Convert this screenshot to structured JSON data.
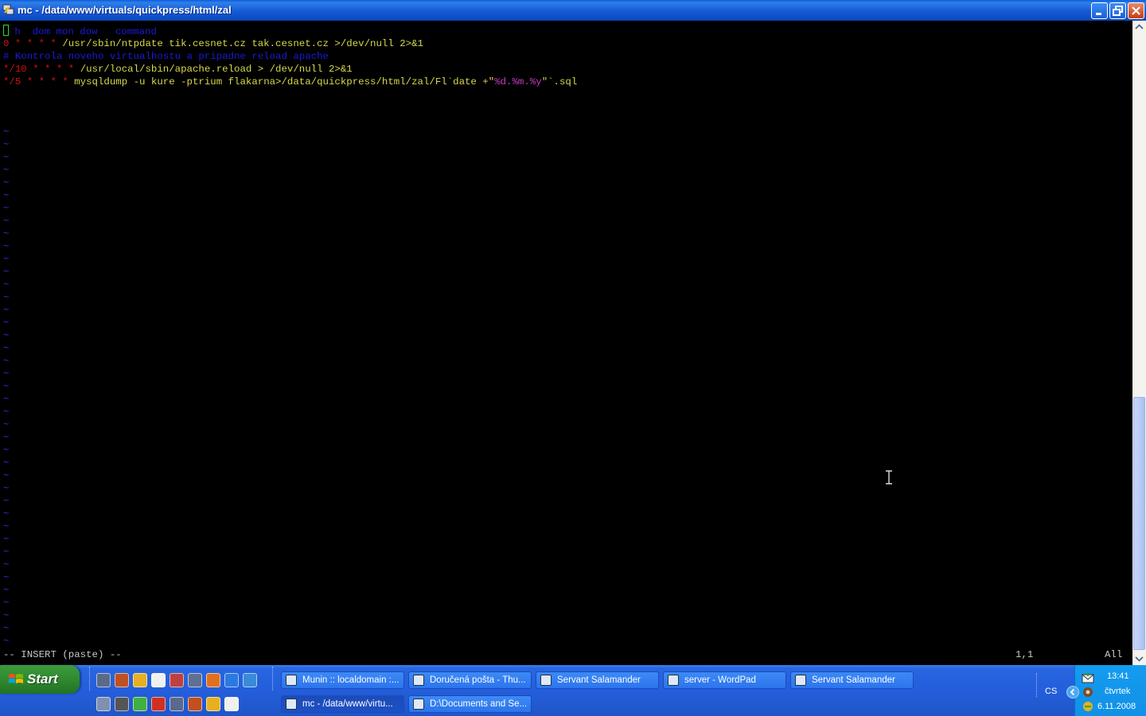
{
  "window": {
    "title": "mc - /data/www/virtuals/quickpress/html/zal"
  },
  "editor": {
    "lines": [
      {
        "segments": [
          {
            "text": "# h  dom mon dow   command",
            "color": "blue"
          }
        ]
      },
      {
        "segments": [
          {
            "text": "0 ",
            "color": "red"
          },
          {
            "text": "* * * * ",
            "color": "red"
          },
          {
            "text": "/usr/sbin/ntpdate tik.cesnet.cz tak.cesnet.cz >/dev/null 2>&1",
            "color": "yellow"
          }
        ]
      },
      {
        "segments": [
          {
            "text": "# Kontrola noveho virtualhostu a pripadne reload apache",
            "color": "blue"
          }
        ]
      },
      {
        "segments": [
          {
            "text": "*/10 ",
            "color": "red"
          },
          {
            "text": "* * * * ",
            "color": "red"
          },
          {
            "text": "/usr/local/sbin/apache.reload > /dev/null 2>&1",
            "color": "yellow"
          }
        ]
      },
      {
        "segments": [
          {
            "text": "*/5 ",
            "color": "red"
          },
          {
            "text": "* * * * ",
            "color": "red"
          },
          {
            "text": "mysqldump -u kure -ptrium flakarna>/data/quickpress/html/zal/Fl`date +\"",
            "color": "yellow"
          },
          {
            "text": "%d.%m.%y",
            "color": "magenta"
          },
          {
            "text": "\"`.sql",
            "color": "yellow"
          }
        ]
      }
    ],
    "tilde": "~",
    "tilde_count": 41,
    "status_mode": "-- INSERT (paste) --",
    "cursor_position": "1,1",
    "scroll_position": "All"
  },
  "colors": {
    "blue": "#1a1ad8",
    "red": "#d01010",
    "yellow": "#d8d84a",
    "magenta": "#c03cc0"
  },
  "taskbar": {
    "start_label": "Start",
    "quicklaunch_row1": [
      "ie-icon",
      "outlook-icon",
      "save-icon",
      "salamander-icon",
      "thunderbird-icon",
      "media-icon",
      "bs-icon",
      "clapper-icon",
      "gear-icon"
    ],
    "quicklaunch_row2": [
      "gmail-icon",
      "download-icon",
      "notes-icon",
      "chrome-icon",
      "notepad-icon",
      "gift-icon",
      "putty-icon",
      "firefox-icon"
    ],
    "tasks_row1": [
      {
        "label": "Munin :: localdomain :...",
        "icon": "firefox-icon"
      },
      {
        "label": "Doručená pošta - Thu...",
        "icon": "thunderbird-icon"
      },
      {
        "label": "Servant Salamander",
        "icon": "salamander-icon"
      },
      {
        "label": "server - WordPad",
        "icon": "wordpad-icon"
      },
      {
        "label": "Servant Salamander",
        "icon": "salamander-icon"
      }
    ],
    "tasks_row2": [
      {
        "label": "mc - /data/www/virtu...",
        "icon": "putty-icon",
        "active": true
      },
      {
        "label": "D:\\Documents and Se...",
        "icon": "notepad-icon"
      }
    ],
    "language": "CS",
    "clock": {
      "time": "13:41",
      "day": "čtvrtek",
      "date": "6.11.2008"
    }
  }
}
